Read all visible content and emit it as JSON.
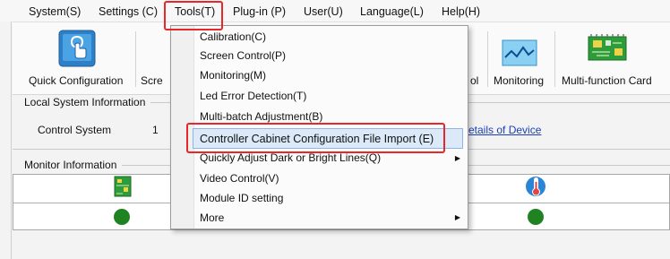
{
  "menubar": {
    "system": "System(S)",
    "settings": "Settings (C)",
    "tools": "Tools(T)",
    "plugin": "Plug-in (P)",
    "user": "User(U)",
    "language": "Language(L)",
    "help": "Help(H)"
  },
  "toolbar": {
    "quick_configuration": "Quick Configuration",
    "screen_partial": "Scre",
    "control_partial": "ol",
    "monitoring": "Monitoring",
    "multifunction_card": "Multi-function Card"
  },
  "local_system": {
    "title": "Local System Information",
    "control_system_label": "Control System",
    "control_system_value": "1",
    "details_link": "etails of Device"
  },
  "monitor": {
    "title": "Monitor Information"
  },
  "tools_menu": {
    "items": [
      {
        "label": "Calibration(C)"
      },
      {
        "label": "Screen Control(P)"
      },
      {
        "label": "Monitoring(M)"
      },
      {
        "label": "Led Error Detection(T)"
      },
      {
        "label": "Multi-batch Adjustment(B)"
      },
      {
        "label": "Controller Cabinet Configuration File Import (E)"
      },
      {
        "label": "Quickly Adjust Dark or Bright Lines(Q)"
      },
      {
        "label": "Video Control(V)"
      },
      {
        "label": "Module ID setting"
      },
      {
        "label": "More"
      }
    ]
  },
  "colors": {
    "highlight_box": "#e8272b",
    "status_ok": "#208321",
    "link": "#1a3fb5",
    "menu_selection": "#dbe9f8"
  }
}
